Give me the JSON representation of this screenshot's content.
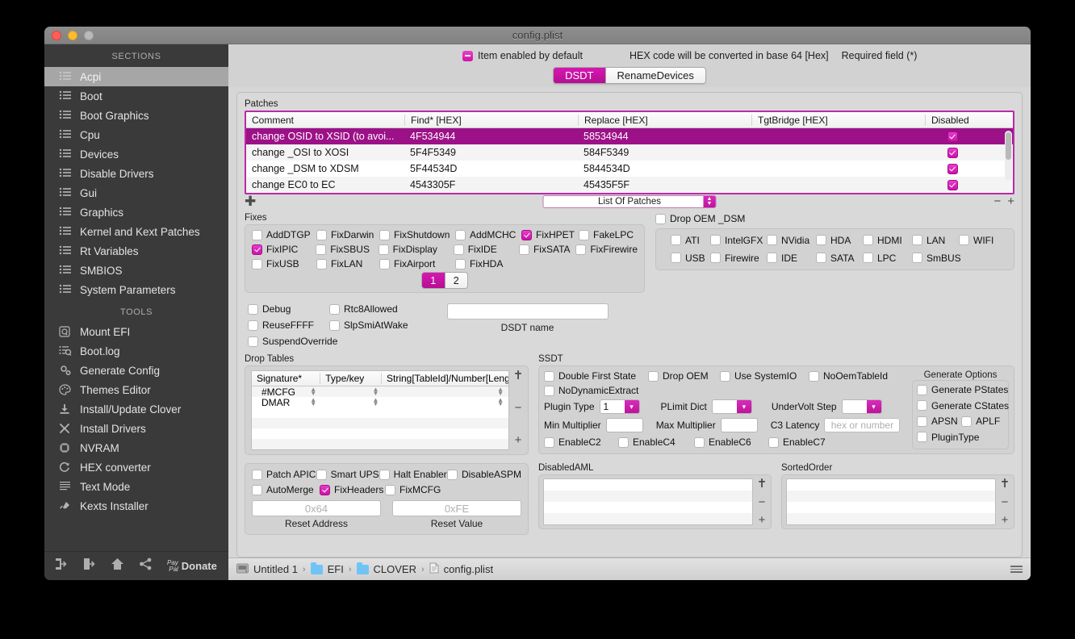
{
  "window": {
    "title": "config.plist"
  },
  "sidebar": {
    "sections_header": "SECTIONS",
    "sections": [
      {
        "label": "Acpi",
        "icon": "list-icon",
        "active": true
      },
      {
        "label": "Boot",
        "icon": "list-icon"
      },
      {
        "label": "Boot Graphics",
        "icon": "list-icon"
      },
      {
        "label": "Cpu",
        "icon": "list-icon"
      },
      {
        "label": "Devices",
        "icon": "list-icon"
      },
      {
        "label": "Disable Drivers",
        "icon": "list-icon"
      },
      {
        "label": "Gui",
        "icon": "list-icon"
      },
      {
        "label": "Graphics",
        "icon": "list-icon"
      },
      {
        "label": "Kernel and Kext Patches",
        "icon": "list-icon"
      },
      {
        "label": "Rt Variables",
        "icon": "list-icon"
      },
      {
        "label": "SMBIOS",
        "icon": "list-icon"
      },
      {
        "label": "System Parameters",
        "icon": "list-icon"
      }
    ],
    "tools_header": "TOOLS",
    "tools": [
      {
        "label": "Mount EFI",
        "icon": "disk-icon"
      },
      {
        "label": "Boot.log",
        "icon": "log-search-icon"
      },
      {
        "label": "Generate Config",
        "icon": "gears-icon"
      },
      {
        "label": "Themes Editor",
        "icon": "palette-icon"
      },
      {
        "label": "Install/Update Clover",
        "icon": "download-icon"
      },
      {
        "label": "Install Drivers",
        "icon": "tools-icon"
      },
      {
        "label": "NVRAM",
        "icon": "chip-icon"
      },
      {
        "label": "HEX converter",
        "icon": "refresh-icon"
      },
      {
        "label": "Text Mode",
        "icon": "text-lines-icon"
      },
      {
        "label": "Kexts Installer",
        "icon": "plug-icon"
      }
    ],
    "footer": {
      "icons": [
        "import-icon",
        "export-icon",
        "home-icon",
        "share-icon"
      ],
      "paypal_line1": "Pay",
      "paypal_line2": "Pal",
      "donate_label": "Donate"
    }
  },
  "topbar": {
    "item_enabled_label": "Item enabled by default",
    "hex_note": "HEX code will be converted in base 64 [Hex]",
    "required_note": "Required field (*)"
  },
  "tabs": [
    {
      "label": "DSDT",
      "selected": true
    },
    {
      "label": "RenameDevices",
      "selected": false
    }
  ],
  "patches": {
    "group_label": "Patches",
    "columns": [
      "Comment",
      "Find* [HEX]",
      "Replace [HEX]",
      "TgtBridge [HEX]",
      "Disabled"
    ],
    "rows": [
      {
        "comment": "change OSID to XSID (to avoi...",
        "find": "4F534944",
        "replace": "58534944",
        "tgt": "",
        "disabled": true,
        "selected": true
      },
      {
        "comment": "change _OSI to XOSI",
        "find": "5F4F5349",
        "replace": "584F5349",
        "tgt": "",
        "disabled": true,
        "selected": false
      },
      {
        "comment": "change _DSM to XDSM",
        "find": "5F44534D",
        "replace": "5844534D",
        "tgt": "",
        "disabled": true,
        "selected": false
      },
      {
        "comment": "change EC0 to EC",
        "find": "4543305F",
        "replace": "45435F5F",
        "tgt": "",
        "disabled": true,
        "selected": false
      }
    ],
    "add_icon": "plus-icon",
    "list_selector_value": "List Of Patches",
    "minus_icon": "minus-icon",
    "plus_icon": "plus-icon"
  },
  "fixes": {
    "group_label": "Fixes",
    "items": [
      {
        "label": "AddDTGP",
        "checked": false
      },
      {
        "label": "FixDarwin",
        "checked": false
      },
      {
        "label": "FixShutdown",
        "checked": false
      },
      {
        "label": "AddMCHC",
        "checked": false
      },
      {
        "label": "FixHPET",
        "checked": true
      },
      {
        "label": "FakeLPC",
        "checked": false
      },
      {
        "label": "FixIPIC",
        "checked": true
      },
      {
        "label": "FixSBUS",
        "checked": false
      },
      {
        "label": "FixDisplay",
        "checked": false
      },
      {
        "label": "FixIDE",
        "checked": false
      },
      {
        "label": "FixSATA",
        "checked": false
      },
      {
        "label": "FixFirewire",
        "checked": false
      },
      {
        "label": "FixUSB",
        "checked": false
      },
      {
        "label": "FixLAN",
        "checked": false
      },
      {
        "label": "FixAirport",
        "checked": false
      },
      {
        "label": "FixHDA",
        "checked": false
      }
    ],
    "pages": [
      {
        "label": "1",
        "active": true
      },
      {
        "label": "2",
        "active": false
      }
    ]
  },
  "drop_oem_dsm": {
    "title": "Drop OEM _DSM",
    "checked": false,
    "row1": [
      {
        "label": "ATI",
        "checked": false
      },
      {
        "label": "IntelGFX",
        "checked": false
      },
      {
        "label": "NVidia",
        "checked": false
      },
      {
        "label": "HDA",
        "checked": false
      },
      {
        "label": "HDMI",
        "checked": false
      },
      {
        "label": "LAN",
        "checked": false
      },
      {
        "label": "WIFI",
        "checked": false
      }
    ],
    "row2": [
      {
        "label": "USB",
        "checked": false
      },
      {
        "label": "Firewire",
        "checked": false
      },
      {
        "label": "IDE",
        "checked": false
      },
      {
        "label": "SATA",
        "checked": false
      },
      {
        "label": "LPC",
        "checked": false
      },
      {
        "label": "SmBUS",
        "checked": false
      }
    ]
  },
  "misc_flags": {
    "items": [
      {
        "label": "Debug",
        "checked": false
      },
      {
        "label": "Rtc8Allowed",
        "checked": false
      },
      {
        "label": "ReuseFFFF",
        "checked": false
      },
      {
        "label": "SlpSmiAtWake",
        "checked": false
      },
      {
        "label": "SuspendOverride",
        "checked": false
      }
    ],
    "dsdt_name_value": "",
    "dsdt_name_label": "DSDT name"
  },
  "drop_tables": {
    "group_label": "Drop Tables",
    "columns": [
      "Signature*",
      "Type/key",
      "String[TableId]/Number[Length]"
    ],
    "rows": [
      {
        "signature": "#MCFG",
        "type": "",
        "value": ""
      },
      {
        "signature": "DMAR",
        "type": "",
        "value": ""
      }
    ],
    "move_icon": "move-vertical-icon",
    "minus_icon": "minus-icon",
    "plus_icon": "plus-icon"
  },
  "ssdt": {
    "group_label": "SSDT",
    "checks_row1": [
      {
        "label": "Double First State",
        "checked": false
      },
      {
        "label": "Drop OEM",
        "checked": false
      },
      {
        "label": "Use SystemIO",
        "checked": false
      },
      {
        "label": "NoOemTableId",
        "checked": false
      }
    ],
    "checks_row2": [
      {
        "label": "NoDynamicExtract",
        "checked": false
      }
    ],
    "plugin_type_label": "Plugin Type",
    "plugin_type_value": "1",
    "plimit_dict_label": "PLimit Dict",
    "plimit_dict_value": "",
    "undervolt_step_label": "UnderVolt Step",
    "undervolt_step_value": "",
    "min_multiplier_label": "Min Multiplier",
    "min_multiplier_value": "",
    "max_multiplier_label": "Max Multiplier",
    "max_multiplier_value": "",
    "c3_latency_label": "C3 Latency",
    "c3_latency_placeholder": "hex or number",
    "checks_row3": [
      {
        "label": "EnableC2",
        "checked": false
      },
      {
        "label": "EnableC4",
        "checked": false
      },
      {
        "label": "EnableC6",
        "checked": false
      },
      {
        "label": "EnableC7",
        "checked": false
      }
    ]
  },
  "generate_options": {
    "title": "Generate Options",
    "items": [
      {
        "label": "Generate PStates",
        "checked": false
      },
      {
        "label": "Generate CStates",
        "checked": false
      },
      {
        "label": "APSN",
        "checked": false
      },
      {
        "label": "APLF",
        "checked": false
      },
      {
        "label": "PluginType",
        "checked": false
      }
    ]
  },
  "apic": {
    "row1": [
      {
        "label": "Patch APIC",
        "checked": false
      },
      {
        "label": "Smart UPS",
        "checked": false
      },
      {
        "label": "Halt Enabler",
        "checked": false
      },
      {
        "label": "DisableASPM",
        "checked": false
      }
    ],
    "row2": [
      {
        "label": "AutoMerge",
        "checked": false
      },
      {
        "label": "FixHeaders",
        "checked": true
      },
      {
        "label": "FixMCFG",
        "checked": false
      }
    ],
    "reset_address_placeholder": "0x64",
    "reset_address_label": "Reset Address",
    "reset_value_placeholder": "0xFE",
    "reset_value_label": "Reset Value"
  },
  "disabled_aml": {
    "label": "DisabledAML",
    "rows": 4
  },
  "sorted_order": {
    "label": "SortedOrder",
    "rows": 4
  },
  "breadcrumb": {
    "items": [
      {
        "label": "Untitled 1",
        "icon": "disk-icon"
      },
      {
        "label": "EFI",
        "icon": "folder-icon"
      },
      {
        "label": "CLOVER",
        "icon": "folder-icon"
      },
      {
        "label": "config.plist",
        "icon": "file-icon"
      }
    ],
    "separator": "›",
    "menu_icon": "hamburger-icon"
  },
  "colors": {
    "accent": "#cf13a8",
    "selection": "#9c1187",
    "sidebar_bg": "#3a3a3a",
    "panel_bg": "#d6d6d6"
  }
}
